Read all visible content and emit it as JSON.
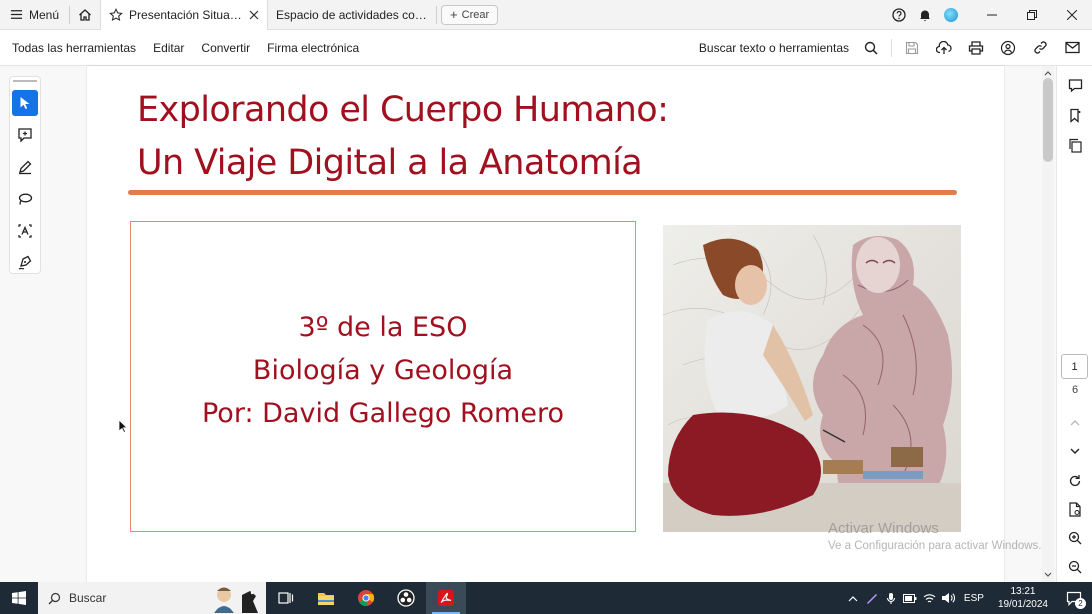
{
  "titlebar": {
    "menu_label": "Menú",
    "tabs": [
      {
        "label": "Presentación Situaci..."
      },
      {
        "label": "Espacio de actividades con..."
      }
    ],
    "new_label": "Crear"
  },
  "toolbar": {
    "items": [
      "Todas las herramientas",
      "Editar",
      "Convertir",
      "Firma electrónica"
    ],
    "search_label": "Buscar texto o herramientas"
  },
  "document": {
    "title_line1": "Explorando el Cuerpo Humano:",
    "title_line2": "Un Viaje Digital a la Anatomía",
    "box_lines": [
      "3º de la ESO",
      "Biología y Geología",
      "Por: David Gallego Romero"
    ]
  },
  "page_nav": {
    "current": "1",
    "total": "6"
  },
  "watermark": {
    "line1": "Activar Windows",
    "line2": "Ve a Configuración para activar Windows."
  },
  "taskbar": {
    "search_placeholder": "Buscar",
    "language": "ESP",
    "time": "13:21",
    "date": "19/01/2024",
    "notifications": "2"
  },
  "colors": {
    "title_red": "#a0101e",
    "accent_orange": "#e07d4f",
    "acrobat_blue": "#1473e6"
  }
}
